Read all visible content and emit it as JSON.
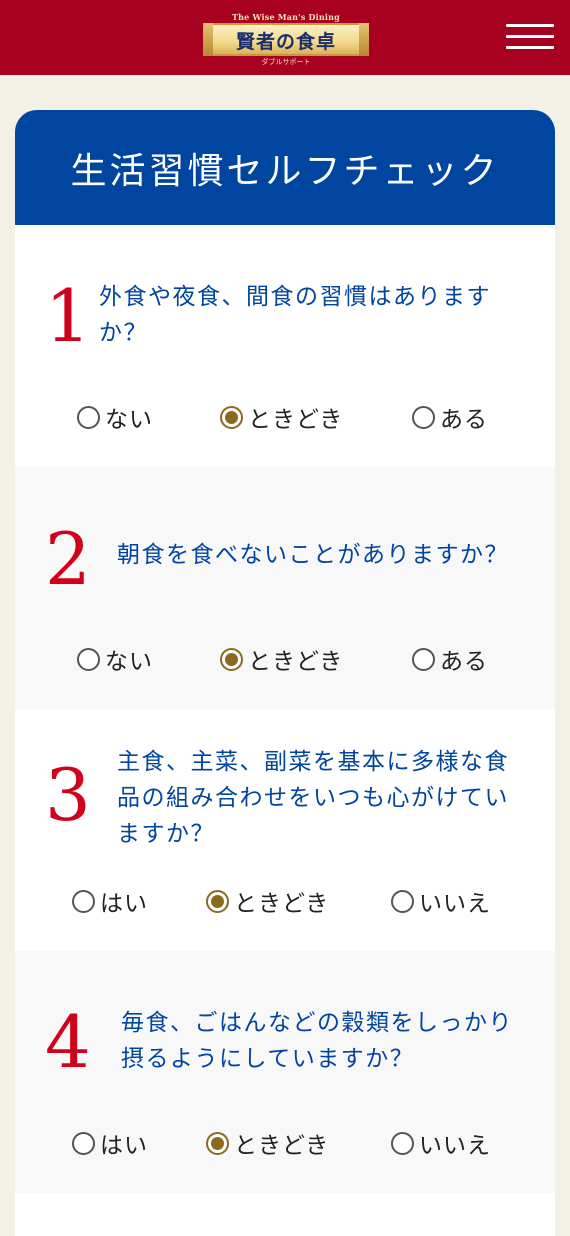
{
  "header": {
    "logo_top": "The Wise Man's Dining",
    "logo_main": "賢者の食卓",
    "logo_sub": "ダブルサポート",
    "menu_icon": "hamburger-menu-icon",
    "bg_color": "#a8001f"
  },
  "card": {
    "title": "生活習慣セルフチェック",
    "title_bg": "#0046a0"
  },
  "questions": [
    {
      "number": "1",
      "line1": "外食や夜食、間食の習慣はありますか？",
      "options": [
        "ない",
        "ときどき",
        "ある"
      ],
      "selected": "ときどき"
    },
    {
      "number": "2",
      "line1": "朝食を食べないことがありますか？",
      "options": [
        "ない",
        "ときどき",
        "ある"
      ],
      "selected": "ときどき"
    },
    {
      "number": "3",
      "line1": "主食、主菜、副菜を基本に多様な食品の組み合わせをいつも心がけていますか？",
      "options": [
        "はい",
        "ときどき",
        "いいえ"
      ],
      "selected": "ときどき"
    },
    {
      "number": "4",
      "line1": "毎食、ごはんなどの穀類をしっかり摂るようにしていますか？",
      "options": [
        "はい",
        "ときどき",
        "いいえ"
      ],
      "selected": "ときどき"
    }
  ],
  "colors": {
    "accent_red": "#d0021b",
    "question_blue": "#0046a0",
    "radio_selected": "#8a6a1f",
    "page_bg": "#f3f0e8"
  }
}
